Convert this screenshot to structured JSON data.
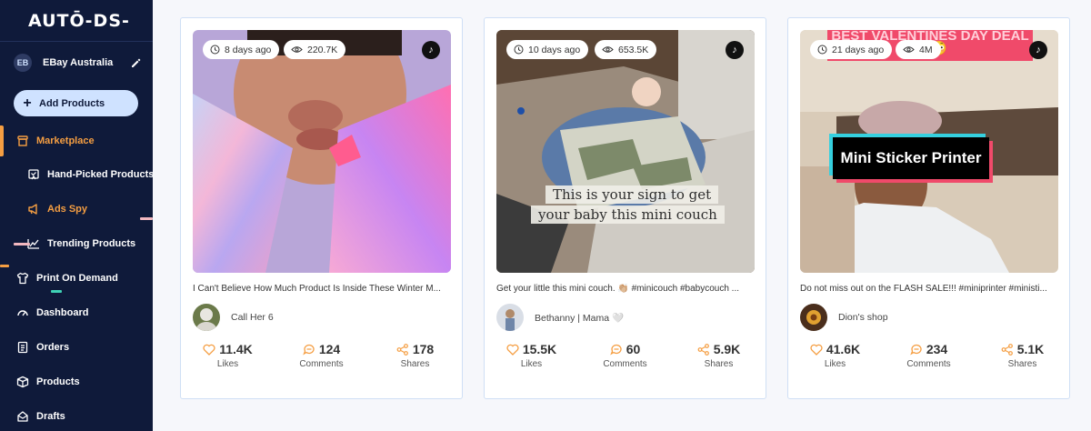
{
  "sidebar": {
    "logo": "AUTŌ-DS-",
    "store": {
      "initials": "EB",
      "name": "EBay Australia"
    },
    "add_products_label": "Add Products",
    "items": [
      {
        "label": "Marketplace",
        "icon": "store-icon",
        "active": true
      },
      {
        "label": "Hand-Picked Products",
        "icon": "hand-picked-icon"
      },
      {
        "label": "Ads Spy",
        "icon": "megaphone-icon",
        "active": true
      },
      {
        "label": "Trending Products",
        "icon": "trending-chart-icon"
      },
      {
        "label": "Print On Demand",
        "icon": "shirt-icon"
      },
      {
        "label": "Dashboard",
        "icon": "gauge-icon"
      },
      {
        "label": "Orders",
        "icon": "orders-icon"
      },
      {
        "label": "Products",
        "icon": "box-icon"
      },
      {
        "label": "Drafts",
        "icon": "drafts-icon"
      }
    ],
    "accent_color": "#f59e42"
  },
  "cards": [
    {
      "age": "8 days ago",
      "views": "220.7K",
      "caption": "I Can't Believe How Much Product Is Inside These Winter M...",
      "author": "Call Her 6",
      "likes": "11.4K",
      "comments": "124",
      "shares": "178"
    },
    {
      "age": "10 days ago",
      "views": "653.5K",
      "overlay_line1": "This is your sign to get",
      "overlay_line2": "your baby this mini couch",
      "caption": "Get your little this mini couch. 👏🏼 #minicouch #babycouch ...",
      "author": "Bethanny | Mama 🤍",
      "likes": "15.5K",
      "comments": "60",
      "shares": "5.9K"
    },
    {
      "age": "21 days ago",
      "views": "4M",
      "banner": "BEST VALENTINES DAY DEAL 😳😳",
      "sticker": "Mini Sticker Printer",
      "caption": "Do not miss out on the FLASH SALE!!! #miniprinter #ministi...",
      "author": "Dion's shop",
      "likes": "41.6K",
      "comments": "234",
      "shares": "5.1K"
    }
  ],
  "stat_labels": {
    "likes": "Likes",
    "comments": "Comments",
    "shares": "Shares"
  },
  "colors": {
    "sidebar_bg": "#0f1a3a",
    "accent": "#f59e42",
    "add_button_bg": "#cfe2ff"
  }
}
